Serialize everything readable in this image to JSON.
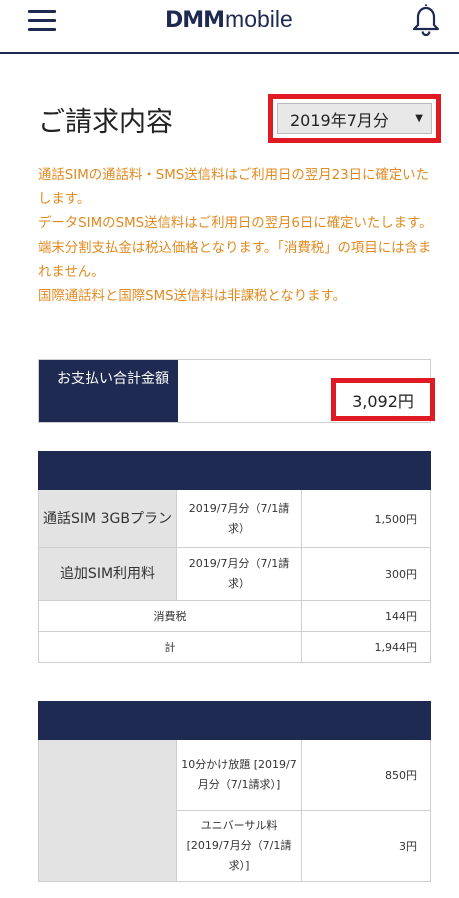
{
  "header": {
    "logo_dmm": "DMM",
    "logo_mobile": "mobile"
  },
  "page": {
    "title": "ご請求内容",
    "month_selected": "2019年7月分"
  },
  "notes": [
    "通話SIMの通話料・SMS送信料はご利用日の翌月23日に確定いたします。",
    "データSIMのSMS送信料はご利用日の翌月6日に確定いたします。",
    "端末分割支払金は税込価格となります。「消費税」の項目には含まれません。",
    "国際通話料と国際SMS送信料は非課税となります。"
  ],
  "total": {
    "label": "お支払い合計金額",
    "value": "3,092円"
  },
  "table1": {
    "rows": [
      {
        "name": "通話SIM 3GBプラン",
        "period": "2019/7月分（7/1請求）",
        "amount": "1,500円"
      },
      {
        "name": "追加SIM利用料",
        "period": "2019/7月分（7/1請求）",
        "amount": "300円"
      }
    ],
    "tax_label": "消費税",
    "tax_amount": "144円",
    "subtotal_label": "計",
    "subtotal_amount": "1,944円"
  },
  "table2": {
    "rows": [
      {
        "period": "10分かけ放題 [2019/7月分（7/1請求）]",
        "amount": "850円"
      },
      {
        "period": "ユニバーサル料 [2019/7月分（7/1請求）]",
        "amount": "3円"
      }
    ]
  },
  "colors": {
    "navy": "#1e2a52",
    "highlight_red": "#e01a22",
    "note_orange": "#e08a1f",
    "cell_gray": "#e3e3e3"
  },
  "icons": [
    "menu-icon",
    "bell-icon",
    "dropdown-arrow-icon"
  ]
}
